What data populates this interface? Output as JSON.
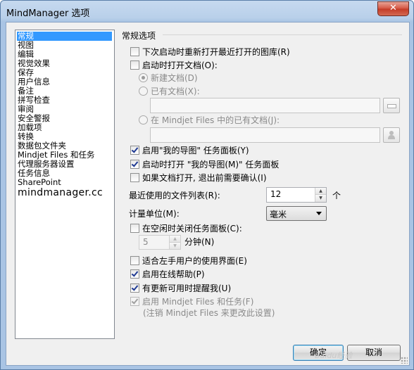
{
  "window": {
    "title": "MindManager 选项",
    "close_label": "✕"
  },
  "nav": {
    "items": [
      "常规",
      "视图",
      "编辑",
      "视觉效果",
      "保存",
      "用户信息",
      "备注",
      "拼写检查",
      "审阅",
      "安全警报",
      "加载项",
      "转换",
      "数据包文件夹",
      "Mindjet Files 和任务",
      "代理服务器设置",
      "任务信息",
      "SharePoint",
      "mindmanager.cc"
    ],
    "selected": "常规"
  },
  "section": {
    "title": "常规选项"
  },
  "options": {
    "reopen_recent": {
      "label": "下次启动时重新打开最近打开的图库(R)",
      "checked": false
    },
    "open_on_startup": {
      "label": "启动时打开文档(O):",
      "checked": false
    },
    "new_document": {
      "label": "新建文档(D)"
    },
    "existing_document": {
      "label": "已有文档(X):"
    },
    "mindjet_files_document": {
      "label": "在 Mindjet Files 中的已有文档(J):"
    },
    "enable_my_maps_panel": {
      "label": "启用\"我的导图\" 任务面板(Y)",
      "checked": true
    },
    "open_my_maps_panel": {
      "label": "启动时打开 \"我的导图(M)\" 任务面板",
      "checked": true
    },
    "confirm_exit": {
      "label": "如果文档打开, 退出前需要确认(I)",
      "checked": false
    },
    "recent_files": {
      "label": "最近使用的文件列表(R):",
      "value": "12",
      "unit": "个"
    },
    "units": {
      "label": "计量单位(M):",
      "value": "毫米"
    },
    "close_panels_idle": {
      "label": "在空闲时关闭任务面板(C):",
      "checked": false
    },
    "idle_minutes": {
      "value": "5",
      "unit": "分钟(N)"
    },
    "left_handed": {
      "label": "适合左手用户的使用界面(E)",
      "checked": false
    },
    "online_help": {
      "label": "启用在线帮助(P)",
      "checked": true
    },
    "update_reminder": {
      "label": "有更新可用时提醒我(U)",
      "checked": true
    },
    "mindjet_files_tasks": {
      "label": "启用 Mindjet Files 和任务(F)",
      "checked": true,
      "note": "(注销 Mindjet Files 来更改此设置)"
    }
  },
  "footer": {
    "ok_label": "确定",
    "cancel_label": "取消",
    "watermark": "Baidu经验"
  },
  "icons": {
    "close": "close-icon",
    "browse": "browse-icon",
    "mindjet_browse": "person-icon",
    "spin_up": "chevron-up-icon",
    "spin_down": "chevron-down-icon",
    "dropdown": "chevron-down-icon"
  }
}
